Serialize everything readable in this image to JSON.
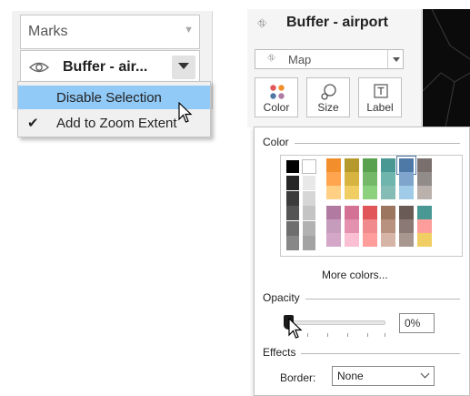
{
  "left_panel": {
    "marks_label": "Marks",
    "layer_name": "Buffer - air...",
    "icons": {
      "visibility": "eye-icon",
      "dropdown": "triangle-down-icon",
      "marks_chevron": "chevron-down-icon"
    },
    "context_menu": {
      "items": [
        {
          "label": "Disable Selection",
          "highlighted": true,
          "checked": false
        },
        {
          "label": "Add to Zoom Extent",
          "highlighted": false,
          "checked": true
        }
      ]
    }
  },
  "right_panel": {
    "layer_title": "Buffer - airport",
    "mark_type": "Map",
    "mark_buttons": [
      {
        "label": "Color",
        "icon": "color-dots-icon"
      },
      {
        "label": "Size",
        "icon": "size-icon"
      },
      {
        "label": "Label",
        "icon": "label-icon"
      }
    ]
  },
  "color_popup": {
    "color_title": "Color",
    "more_colors": "More colors...",
    "opacity_title": "Opacity",
    "opacity_value": "0%",
    "opacity_fraction": 0,
    "effects_title": "Effects",
    "border_label": "Border:",
    "border_value": "None",
    "selected_color": "#4e79a7",
    "palette_colors": {
      "grays": [
        "#000000",
        "#ffffff",
        "#262626",
        "#e8e8e8",
        "#3b3b3b",
        "#d6d6d6",
        "#545454",
        "#c4c4c4",
        "#6e6e6e",
        "#b2b2b2",
        "#878787",
        "#a3a3a3"
      ],
      "top_columns": [
        [
          "#f28e2b",
          "#ffa550",
          "#ffd083"
        ],
        [
          "#b6992d",
          "#d7b340",
          "#f1ce63"
        ],
        [
          "#59a14f",
          "#76b86a",
          "#8cd17d"
        ],
        [
          "#499894",
          "#6fb5ad",
          "#86bcb6"
        ],
        [
          "#4e79a7",
          "#7fa5cd",
          "#a0cbe8"
        ],
        [
          "#79706e",
          "#918b89",
          "#bab0ac"
        ]
      ],
      "bottom_columns": [
        [
          "#b07aa1",
          "#c69cbc",
          "#d4a6c8"
        ],
        [
          "#d37295",
          "#e491b0",
          "#fabfd2"
        ],
        [
          "#e15759",
          "#f08a8c",
          "#ff9d9a"
        ],
        [
          "#9d7660",
          "#b9927f",
          "#d7b5a6"
        ],
        [
          "#6b5b57",
          "#8a7975",
          "#a8978f"
        ],
        [
          "#499894",
          "#ff9d9a",
          "#f1ce63"
        ]
      ]
    }
  },
  "cursors": [
    "arrow-cursor-icon",
    "arrow-cursor-icon"
  ]
}
